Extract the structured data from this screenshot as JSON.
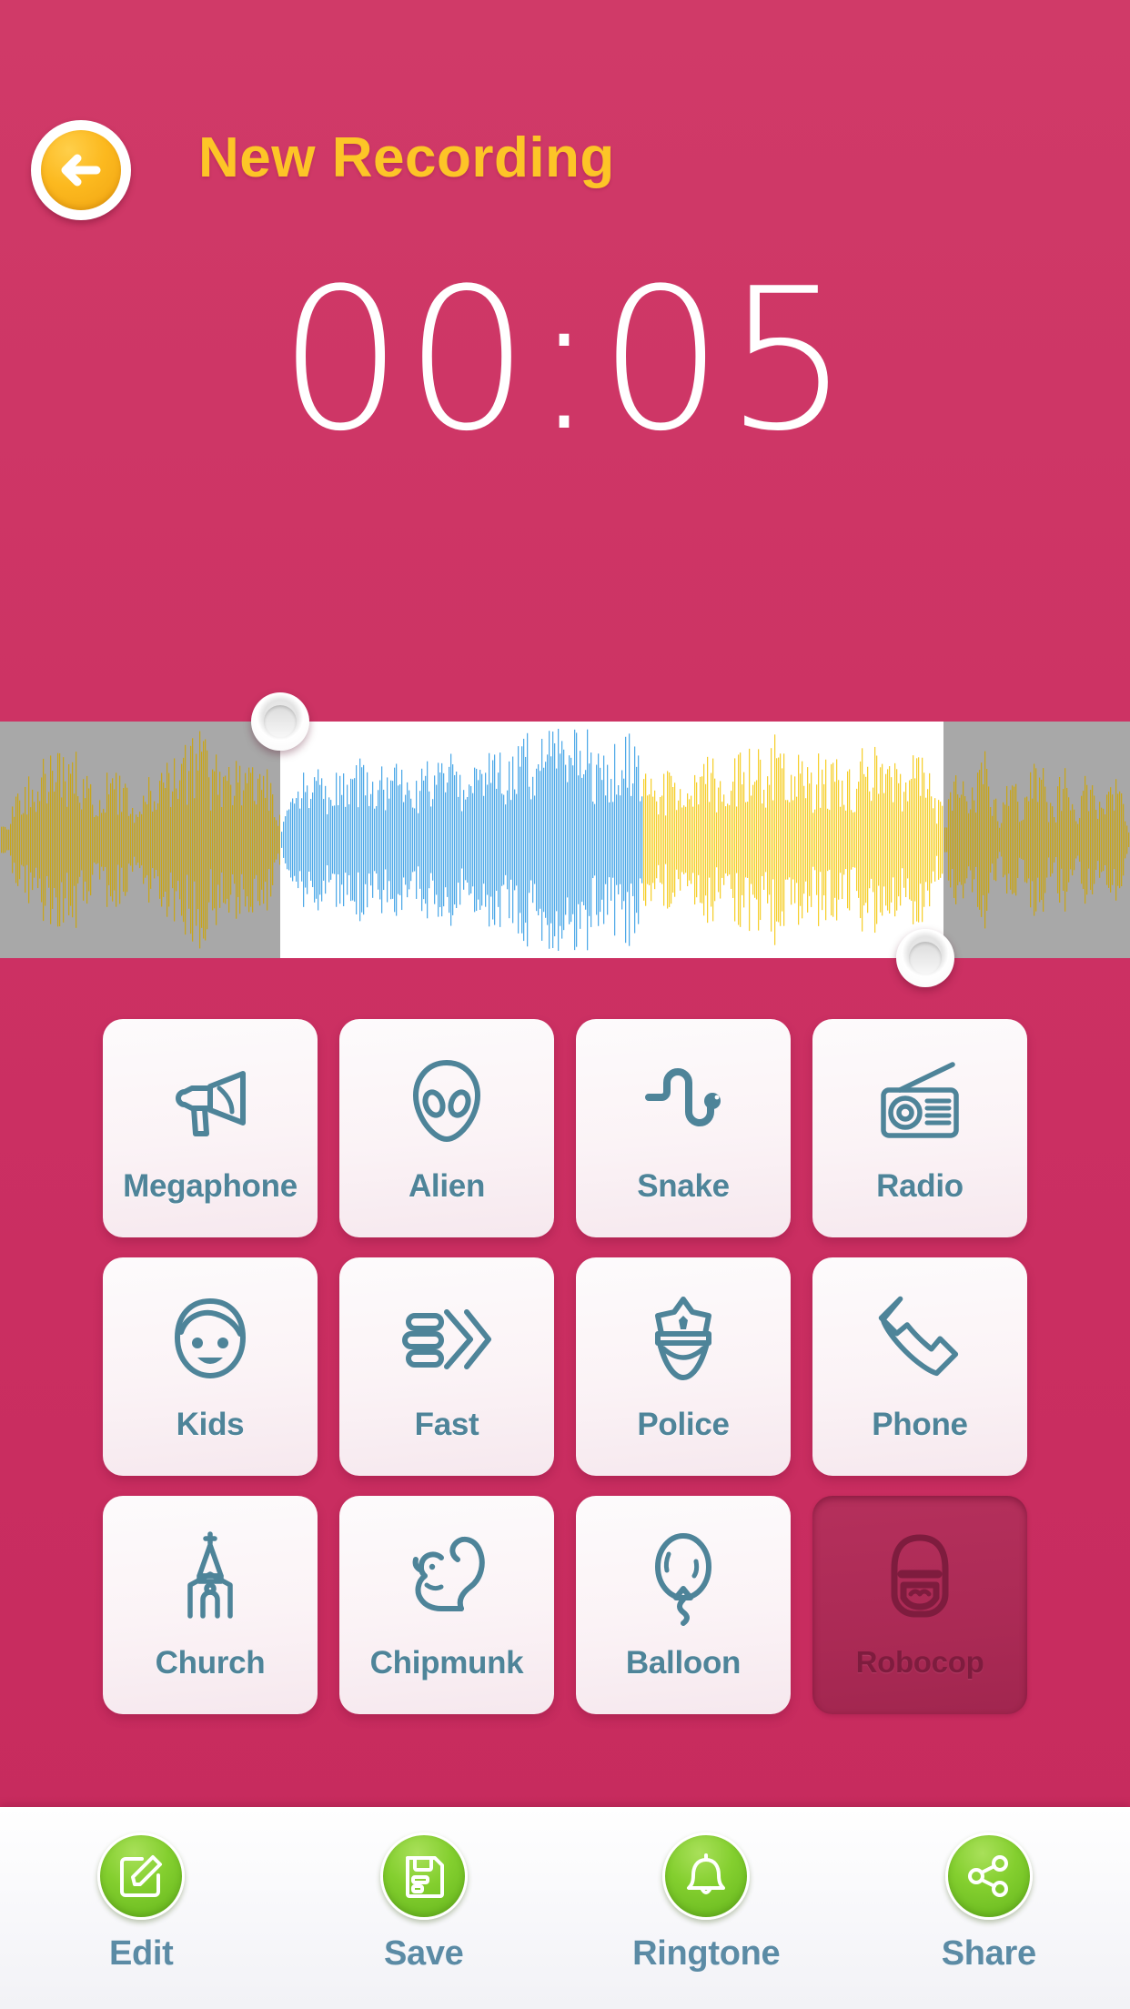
{
  "header": {
    "title": "New Recording",
    "back_icon": "arrow-left-icon"
  },
  "timer": {
    "value": "00:05"
  },
  "waveform": {
    "selection_start_label": "left-trim-handle",
    "selection_end_label": "right-trim-handle",
    "colors": {
      "dimmed_background": "#a8a8a8",
      "dimmed_wave": "#c8a51b",
      "selection_background": "#ffffff",
      "played_wave": "#4fa9e8",
      "unplayed_wave": "#f6cf2e"
    }
  },
  "effects": {
    "selected": "Robocop",
    "items": [
      {
        "label": "Megaphone",
        "icon": "megaphone-icon",
        "selected": false
      },
      {
        "label": "Alien",
        "icon": "alien-head-icon",
        "selected": false
      },
      {
        "label": "Snake",
        "icon": "snake-icon",
        "selected": false
      },
      {
        "label": "Radio",
        "icon": "radio-icon",
        "selected": false
      },
      {
        "label": "Kids",
        "icon": "kid-face-icon",
        "selected": false
      },
      {
        "label": "Fast",
        "icon": "fast-forward-icon",
        "selected": false
      },
      {
        "label": "Police",
        "icon": "police-hat-icon",
        "selected": false
      },
      {
        "label": "Phone",
        "icon": "phone-handset-icon",
        "selected": false
      },
      {
        "label": "Church",
        "icon": "church-icon",
        "selected": false
      },
      {
        "label": "Chipmunk",
        "icon": "squirrel-icon",
        "selected": false
      },
      {
        "label": "Balloon",
        "icon": "balloon-icon",
        "selected": false
      },
      {
        "label": "Robocop",
        "icon": "robocop-head-icon",
        "selected": true
      }
    ]
  },
  "bottom_bar": {
    "items": [
      {
        "label": "Edit",
        "icon": "pencil-edit-icon"
      },
      {
        "label": "Save",
        "icon": "floppy-disk-icon"
      },
      {
        "label": "Ringtone",
        "icon": "bell-icon"
      },
      {
        "label": "Share",
        "icon": "share-nodes-icon"
      }
    ]
  },
  "colors": {
    "background_pink": "#cb2f62",
    "title_yellow": "#fdc527",
    "tile_label_teal": "#4e8499",
    "selected_tile": "#ab2a55",
    "button_green": "#84cf2f"
  }
}
